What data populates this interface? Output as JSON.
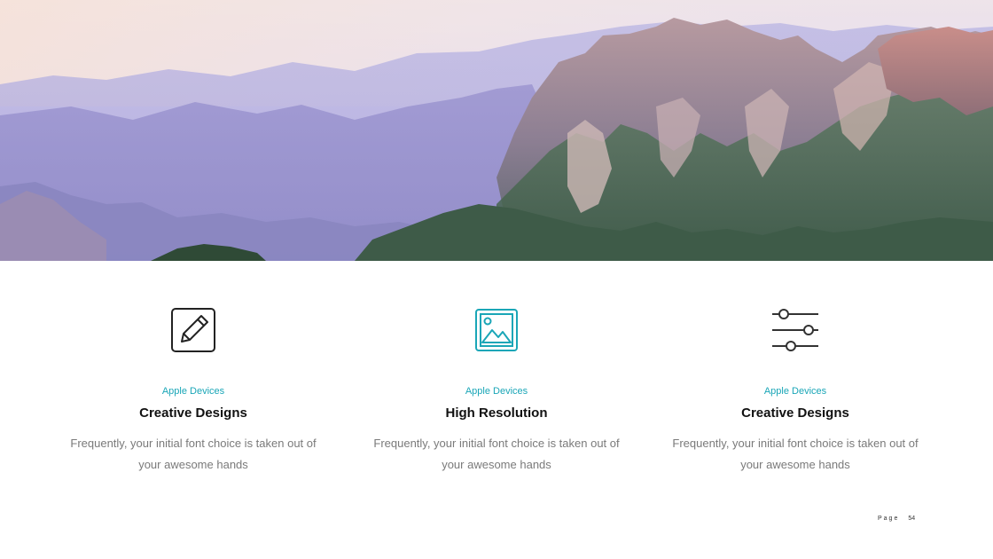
{
  "colors": {
    "accent": "#1aa6b7",
    "text_dark": "#111111",
    "text_muted": "#7a7a7a",
    "icon_dark": "#222222"
  },
  "hero": {
    "image": "mountain-landscape-photo"
  },
  "features": [
    {
      "icon": "pencil-edit-icon",
      "kicker": "Apple Devices",
      "title": "Creative Designs",
      "desc": "Frequently, your initial font choice is taken out of your awesome hands"
    },
    {
      "icon": "image-icon",
      "kicker": "Apple Devices",
      "title": "High Resolution",
      "desc": "Frequently, your initial font choice is taken out of your awesome hands"
    },
    {
      "icon": "sliders-icon",
      "kicker": "Apple Devices",
      "title": "Creative Designs",
      "desc": "Frequently, your initial font choice is taken out of your awesome hands"
    }
  ],
  "footer": {
    "page_label": "Page",
    "page_number": "54"
  }
}
